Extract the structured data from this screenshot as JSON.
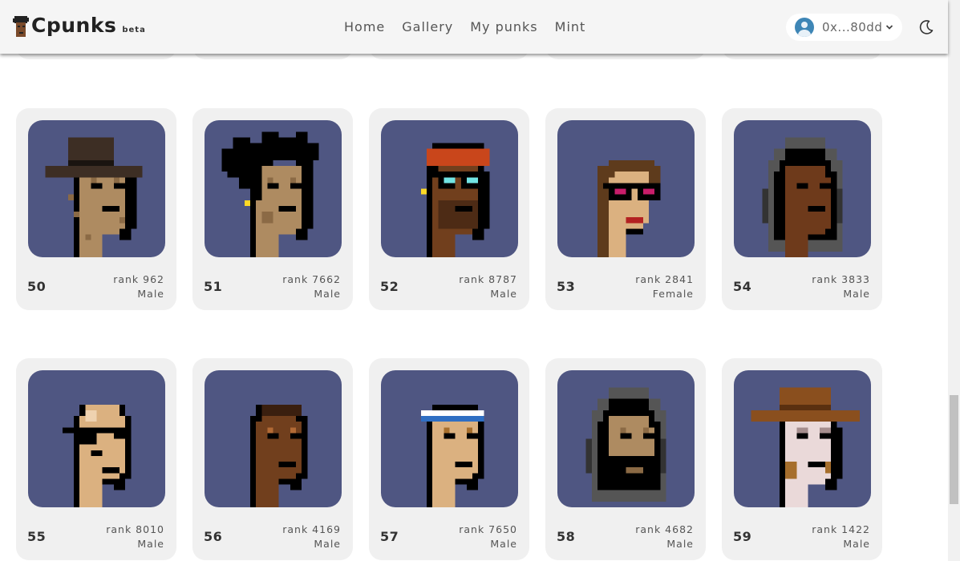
{
  "header": {
    "logo_text": "Cpunks",
    "beta_label": "beta",
    "nav": [
      "Home",
      "Gallery",
      "My punks",
      "Mint"
    ],
    "wallet_address": "0x...80dd",
    "theme_icon": "moon-icon"
  },
  "punks": [
    {
      "id": "50",
      "rank": "rank 962",
      "gender": "Male"
    },
    {
      "id": "51",
      "rank": "rank 7662",
      "gender": "Male"
    },
    {
      "id": "52",
      "rank": "rank 8787",
      "gender": "Male"
    },
    {
      "id": "53",
      "rank": "rank 2841",
      "gender": "Female"
    },
    {
      "id": "54",
      "rank": "rank 3833",
      "gender": "Male"
    },
    {
      "id": "55",
      "rank": "rank 8010",
      "gender": "Male"
    },
    {
      "id": "56",
      "rank": "rank 4169",
      "gender": "Male"
    },
    {
      "id": "57",
      "rank": "rank 7650",
      "gender": "Male"
    },
    {
      "id": "58",
      "rank": "rank 4682",
      "gender": "Male"
    },
    {
      "id": "59",
      "rank": "rank 1422",
      "gender": "Male"
    }
  ],
  "colors": {
    "punk_background": "#4f5682",
    "card_background": "#f0f0f0",
    "header_background": "#f5f5f5"
  }
}
